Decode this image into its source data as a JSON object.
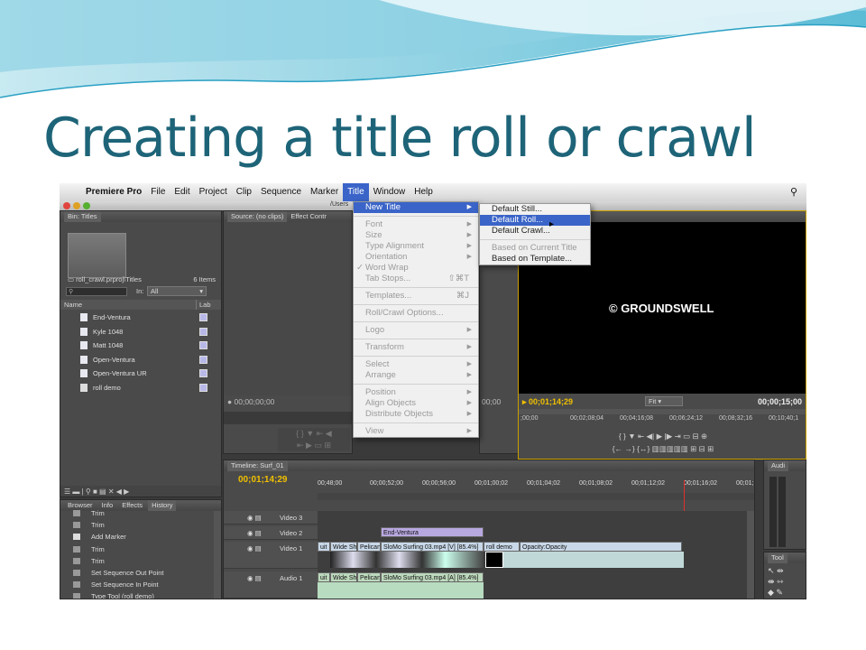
{
  "slide": {
    "title": "Creating a title roll or crawl"
  },
  "menubar": {
    "app": "Premiere Pro",
    "items": [
      "File",
      "Edit",
      "Project",
      "Clip",
      "Sequence",
      "Marker",
      "Title",
      "Window",
      "Help"
    ],
    "active": "Title",
    "path": "/Users"
  },
  "bin": {
    "tab": "Bin: Titles",
    "project": "roll_crawl.prproj\\Titles",
    "count": "6 Items",
    "in_label": "In:",
    "in_value": "All",
    "col_name": "Name",
    "col_label": "Lab",
    "items": [
      "End-Ventura",
      "Kyle 1048",
      "Matt 1048",
      "Open-Ventura",
      "Open-Ventura UR",
      "roll demo"
    ]
  },
  "source": {
    "tab": "Source: (no clips)",
    "tab2": "Effect Contr",
    "timecode": "00;00;00;00",
    "timecode_right": "00;00"
  },
  "title_menu": {
    "items": [
      {
        "label": "New Title",
        "state": "hl",
        "sub": true
      },
      {
        "sep": true
      },
      {
        "label": "Font",
        "state": "dis",
        "sub": true
      },
      {
        "label": "Size",
        "state": "dis",
        "sub": true
      },
      {
        "label": "Type Alignment",
        "state": "dis",
        "sub": true
      },
      {
        "label": "Orientation",
        "state": "dis",
        "sub": true
      },
      {
        "label": "Word Wrap",
        "state": "dis",
        "check": "✓"
      },
      {
        "label": "Tab Stops...",
        "state": "dis",
        "shortcut": "⇧⌘T"
      },
      {
        "sep": true
      },
      {
        "label": "Templates...",
        "state": "dis",
        "shortcut": "⌘J"
      },
      {
        "sep": true
      },
      {
        "label": "Roll/Crawl Options...",
        "state": "dis"
      },
      {
        "sep": true
      },
      {
        "label": "Logo",
        "state": "dis",
        "sub": true
      },
      {
        "sep": true
      },
      {
        "label": "Transform",
        "state": "dis",
        "sub": true
      },
      {
        "sep": true
      },
      {
        "label": "Select",
        "state": "dis",
        "sub": true
      },
      {
        "label": "Arrange",
        "state": "dis",
        "sub": true
      },
      {
        "sep": true
      },
      {
        "label": "Position",
        "state": "dis",
        "sub": true
      },
      {
        "label": "Align Objects",
        "state": "dis",
        "sub": true
      },
      {
        "label": "Distribute Objects",
        "state": "dis",
        "sub": true
      },
      {
        "sep": true
      },
      {
        "label": "View",
        "state": "dis",
        "sub": true
      }
    ]
  },
  "new_title_submenu": {
    "items": [
      {
        "label": "Default Still...",
        "state": ""
      },
      {
        "label": "Default Roll...",
        "state": "hl"
      },
      {
        "label": "Default Crawl...",
        "state": ""
      },
      {
        "sep": true
      },
      {
        "label": "Based on Current Title",
        "state": "dis"
      },
      {
        "label": "Based on Template...",
        "state": ""
      }
    ]
  },
  "program": {
    "logo_text": "© GROUNDSWELL",
    "timecode": "00;01;14;29",
    "fit": "Fit",
    "duration": "00;00;15;00",
    "ruler": [
      ";00;00",
      "00;02;08;04",
      "00;04;16;08",
      "00;06;24;12",
      "00;08;32;16",
      "00;10;40;1"
    ]
  },
  "history": {
    "tabs": [
      "Browser",
      "Info",
      "Effects",
      "History"
    ],
    "active_tab": "History",
    "rows": [
      "Trim",
      "Trim",
      "Add Marker",
      "Trim",
      "Trim",
      "Set Sequence Out Point",
      "Set Sequence In Point",
      "Type Tool (roll demo)"
    ]
  },
  "timeline": {
    "tab": "Timeline: Surf_01",
    "timecode": "00;01;14;29",
    "ruler": [
      "00;48;00",
      "00;00;52;00",
      "00;00;56;00",
      "00;01;00;02",
      "00;01;04;02",
      "00;01;08;02",
      "00;01;12;02",
      "00;01;16;02",
      "00;01;"
    ],
    "tracks": [
      "Video 3",
      "Video 2",
      "Video 1",
      "Audio 1"
    ],
    "clip_v2": "End-Ventura",
    "clips_v1": [
      "uit",
      "Wide Sh",
      "Pelican",
      "SloMo Surfing 03.mp4 [V] [85.4%]",
      "roll demo",
      "Opacity:Opacity"
    ],
    "clips_a1": [
      "uit",
      "Wide Sh",
      "Pelican",
      "SloMo Surfing 03.mp4 [A] [85.4%]"
    ]
  },
  "audio_meter": {
    "tab": "Audi"
  },
  "tools": {
    "tab": "Tool"
  }
}
